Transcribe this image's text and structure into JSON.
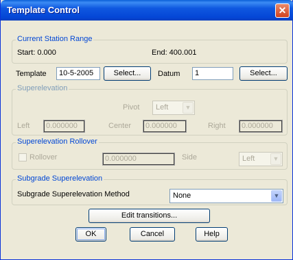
{
  "window": {
    "title": "Template Control",
    "close_glyph": "✕"
  },
  "station_range": {
    "legend": "Current Station Range",
    "start": "Start: 0.000",
    "end": "End: 400.001"
  },
  "template": {
    "label": "Template",
    "value": "10-5-2005",
    "select_label": "Select..."
  },
  "datum": {
    "label": "Datum",
    "value": "1",
    "select_label": "Select..."
  },
  "superelevation": {
    "legend": "Superelevation",
    "pivot_label": "Pivot",
    "pivot_value": "Left",
    "left_label": "Left",
    "left_value": "0.000000",
    "center_label": "Center",
    "center_value": "0.000000",
    "right_label": "Right",
    "right_value": "0.000000"
  },
  "rollover": {
    "legend": "Superelevation Rollover",
    "checkbox_label": "Rollover",
    "value": "0.000000",
    "side_label": "Side",
    "side_value": "Left"
  },
  "subgrade": {
    "legend": "Subgrade Superelevation",
    "method_label": "Subgrade Superelevation Method",
    "method_value": "None"
  },
  "buttons": {
    "edit_transitions": "Edit transitions...",
    "ok": "OK",
    "cancel": "Cancel",
    "help": "Help"
  },
  "icons": {
    "dropdown": "chevron-down-icon",
    "close": "close-icon"
  },
  "colors": {
    "titlebar": "#0a5fd8",
    "legend": "#0046d5",
    "dialog_bg": "#ece9d8"
  }
}
